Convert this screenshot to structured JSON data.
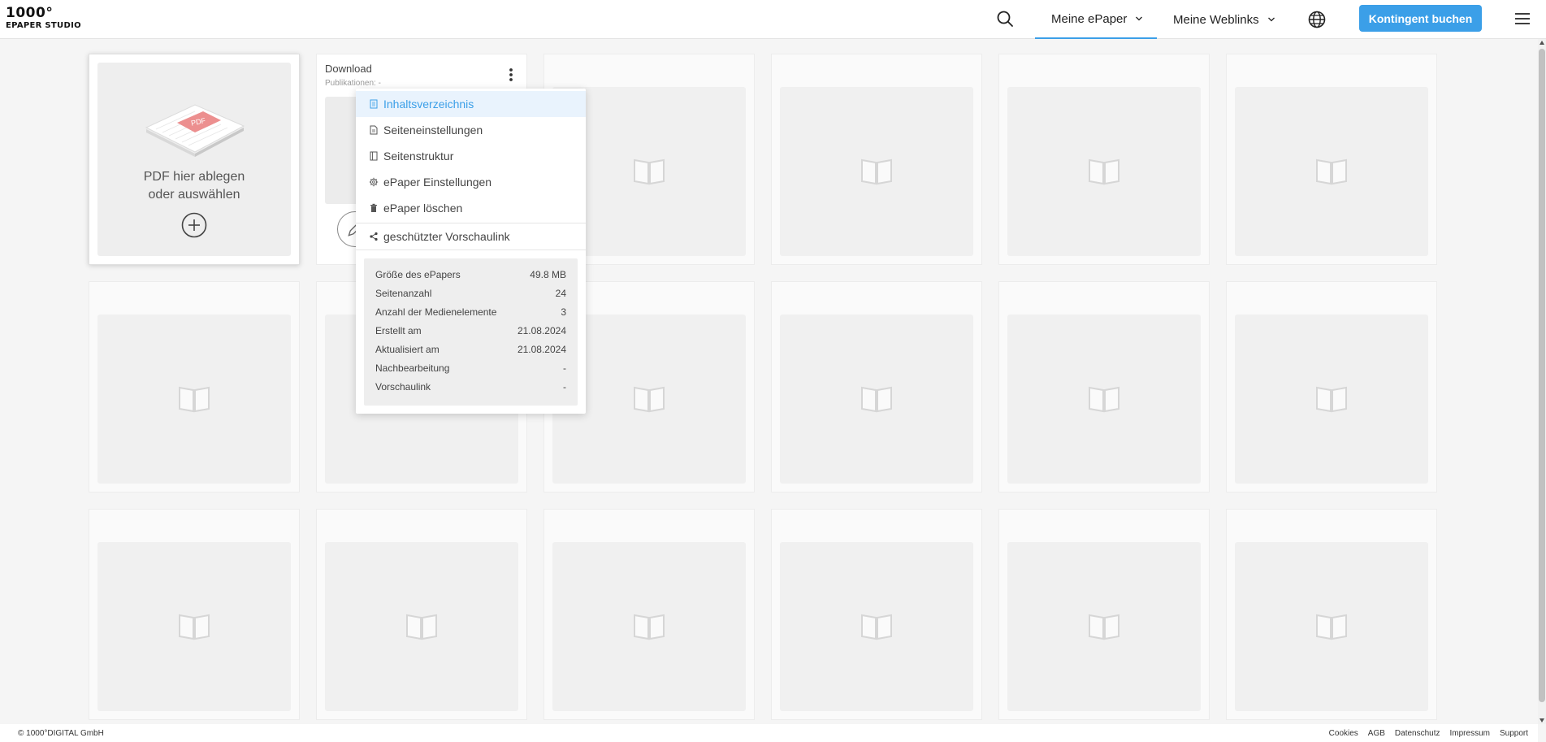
{
  "logo": {
    "line1": "1000°",
    "line2": "EPAPER STUDIO"
  },
  "nav": {
    "search_icon": "search-icon",
    "epaper_label": "Meine ePaper",
    "weblinks_label": "Meine Weblinks",
    "language_icon": "globe-icon",
    "cta_label": "Kontingent buchen",
    "menu_icon": "hamburger-icon",
    "accent_color": "#3b9fe8"
  },
  "upload": {
    "line1": "PDF hier ablegen",
    "line2": "oder auswählen",
    "graphic_label": "PDF"
  },
  "download_card": {
    "title": "Download",
    "subtitle": "Publikationen: -"
  },
  "context_menu": {
    "items": [
      {
        "label": "Inhaltsverzeichnis",
        "icon": "document-list-icon"
      },
      {
        "label": "Seiteneinstellungen",
        "icon": "page-settings-icon"
      },
      {
        "label": "Seitenstruktur",
        "icon": "book-structure-icon"
      },
      {
        "label": "ePaper Einstellungen",
        "icon": "gear-icon"
      },
      {
        "label": "ePaper löschen",
        "icon": "trash-icon"
      },
      {
        "label": "geschützter Vorschaulink",
        "icon": "share-icon"
      }
    ],
    "info": [
      {
        "label": "Größe des ePapers",
        "value": "49.8 MB"
      },
      {
        "label": "Seitenanzahl",
        "value": "24"
      },
      {
        "label": "Anzahl der Medienelemente",
        "value": "3"
      },
      {
        "label": "Erstellt am",
        "value": "21.08.2024"
      },
      {
        "label": "Aktualisiert am",
        "value": "21.08.2024"
      },
      {
        "label": "Nachbearbeitung",
        "value": "-"
      },
      {
        "label": "Vorschaulink",
        "value": "-"
      }
    ]
  },
  "footer": {
    "copyright": "© 1000°DIGITAL GmbH",
    "links": [
      "Cookies",
      "AGB",
      "Datenschutz",
      "Impressum",
      "Support"
    ]
  }
}
